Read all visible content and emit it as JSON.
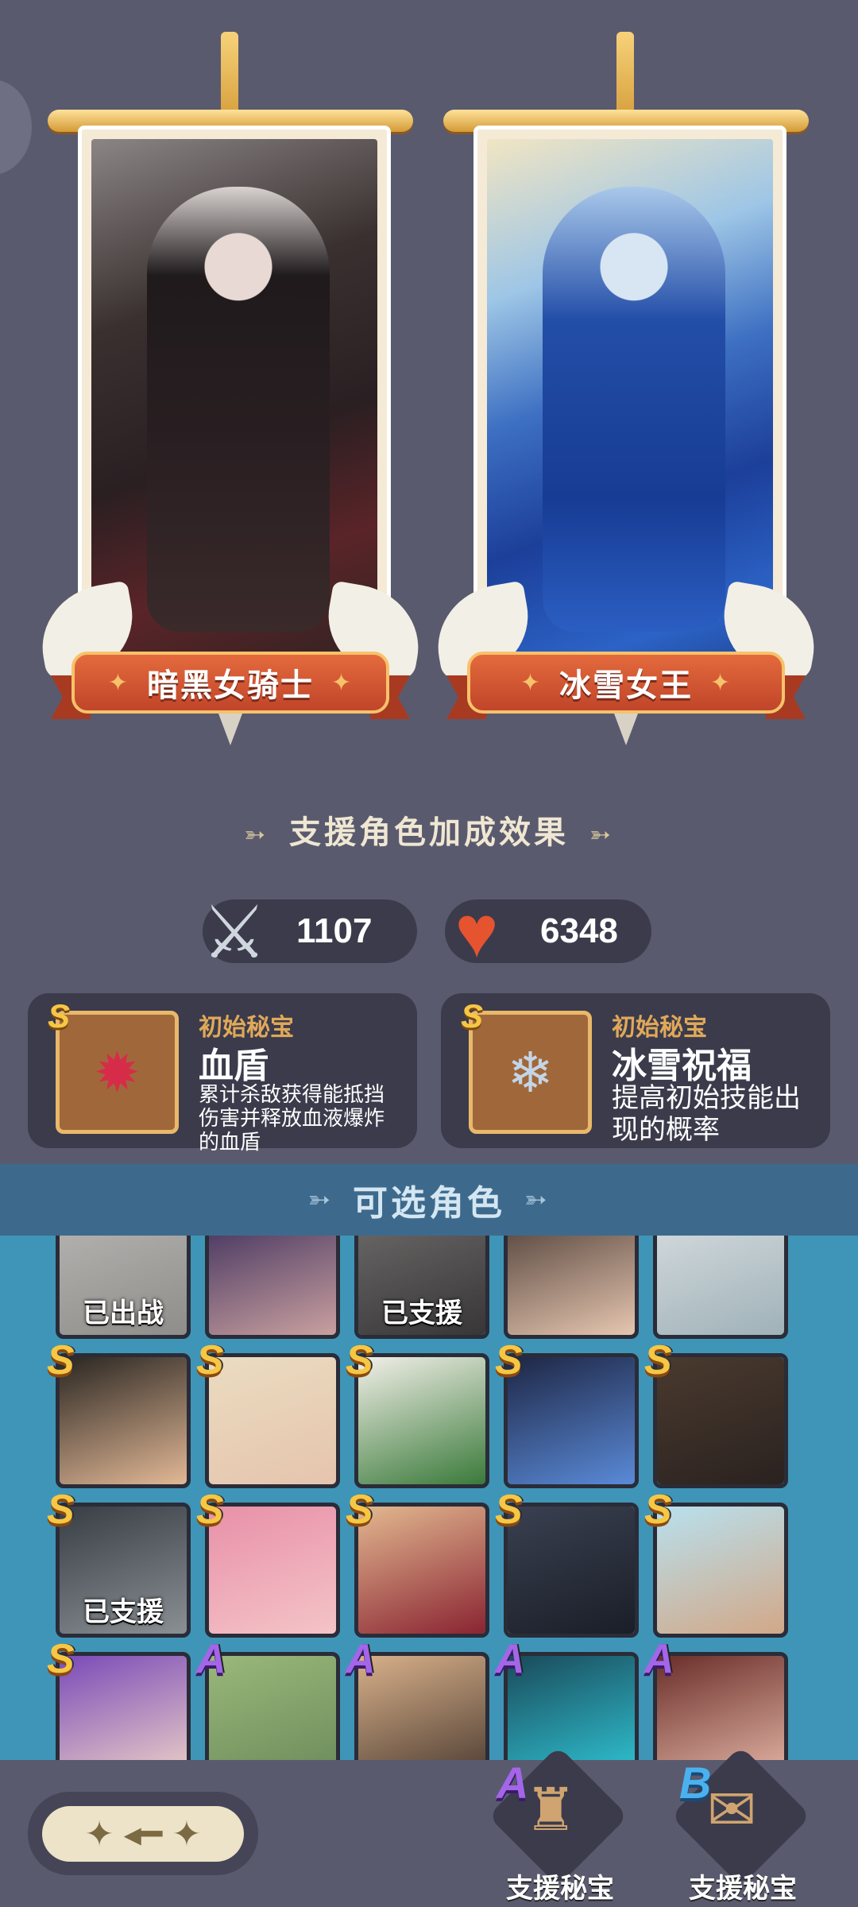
{
  "heroes": [
    {
      "name": "暗黑女骑士"
    },
    {
      "name": "冰雪女王"
    }
  ],
  "bonus_section": {
    "title": "支援角色加成效果"
  },
  "stats": {
    "attack": "1107",
    "hp": "6348"
  },
  "relics": [
    {
      "rank": "S",
      "kind": "初始秘宝",
      "name": "血盾",
      "desc": "累计杀敌获得能抵挡伤害并释放血液爆炸的血盾",
      "icon": "blood-shield-icon"
    },
    {
      "rank": "S",
      "kind": "初始秘宝",
      "name": "冰雪祝福",
      "desc": "提高初始技能出现的概率",
      "icon": "ice-blessing-icon"
    }
  ],
  "picker": {
    "title": "可选角色",
    "cells": [
      {
        "rank": "",
        "state": "已出战"
      },
      {
        "rank": "",
        "state": ""
      },
      {
        "rank": "",
        "state": "已支援"
      },
      {
        "rank": "",
        "state": ""
      },
      {
        "rank": "",
        "state": ""
      },
      {
        "rank": "S",
        "state": ""
      },
      {
        "rank": "S",
        "state": ""
      },
      {
        "rank": "S",
        "state": ""
      },
      {
        "rank": "S",
        "state": ""
      },
      {
        "rank": "S",
        "state": ""
      },
      {
        "rank": "S",
        "state": "已支援"
      },
      {
        "rank": "S",
        "state": ""
      },
      {
        "rank": "S",
        "state": ""
      },
      {
        "rank": "S",
        "state": ""
      },
      {
        "rank": "S",
        "state": ""
      },
      {
        "rank": "S",
        "state": ""
      },
      {
        "rank": "A",
        "state": ""
      },
      {
        "rank": "A",
        "state": ""
      },
      {
        "rank": "A",
        "state": ""
      },
      {
        "rank": "A",
        "state": ""
      }
    ]
  },
  "bottom": {
    "support_relics": [
      {
        "rank": "A",
        "label": "支援秘宝"
      },
      {
        "rank": "B",
        "label": "支援秘宝"
      }
    ]
  },
  "colors": {
    "accent_gold": "#f6c744",
    "rank_a": "#a466e8",
    "rank_b": "#4bb1ee",
    "ribbon_red": "#d4553a"
  }
}
